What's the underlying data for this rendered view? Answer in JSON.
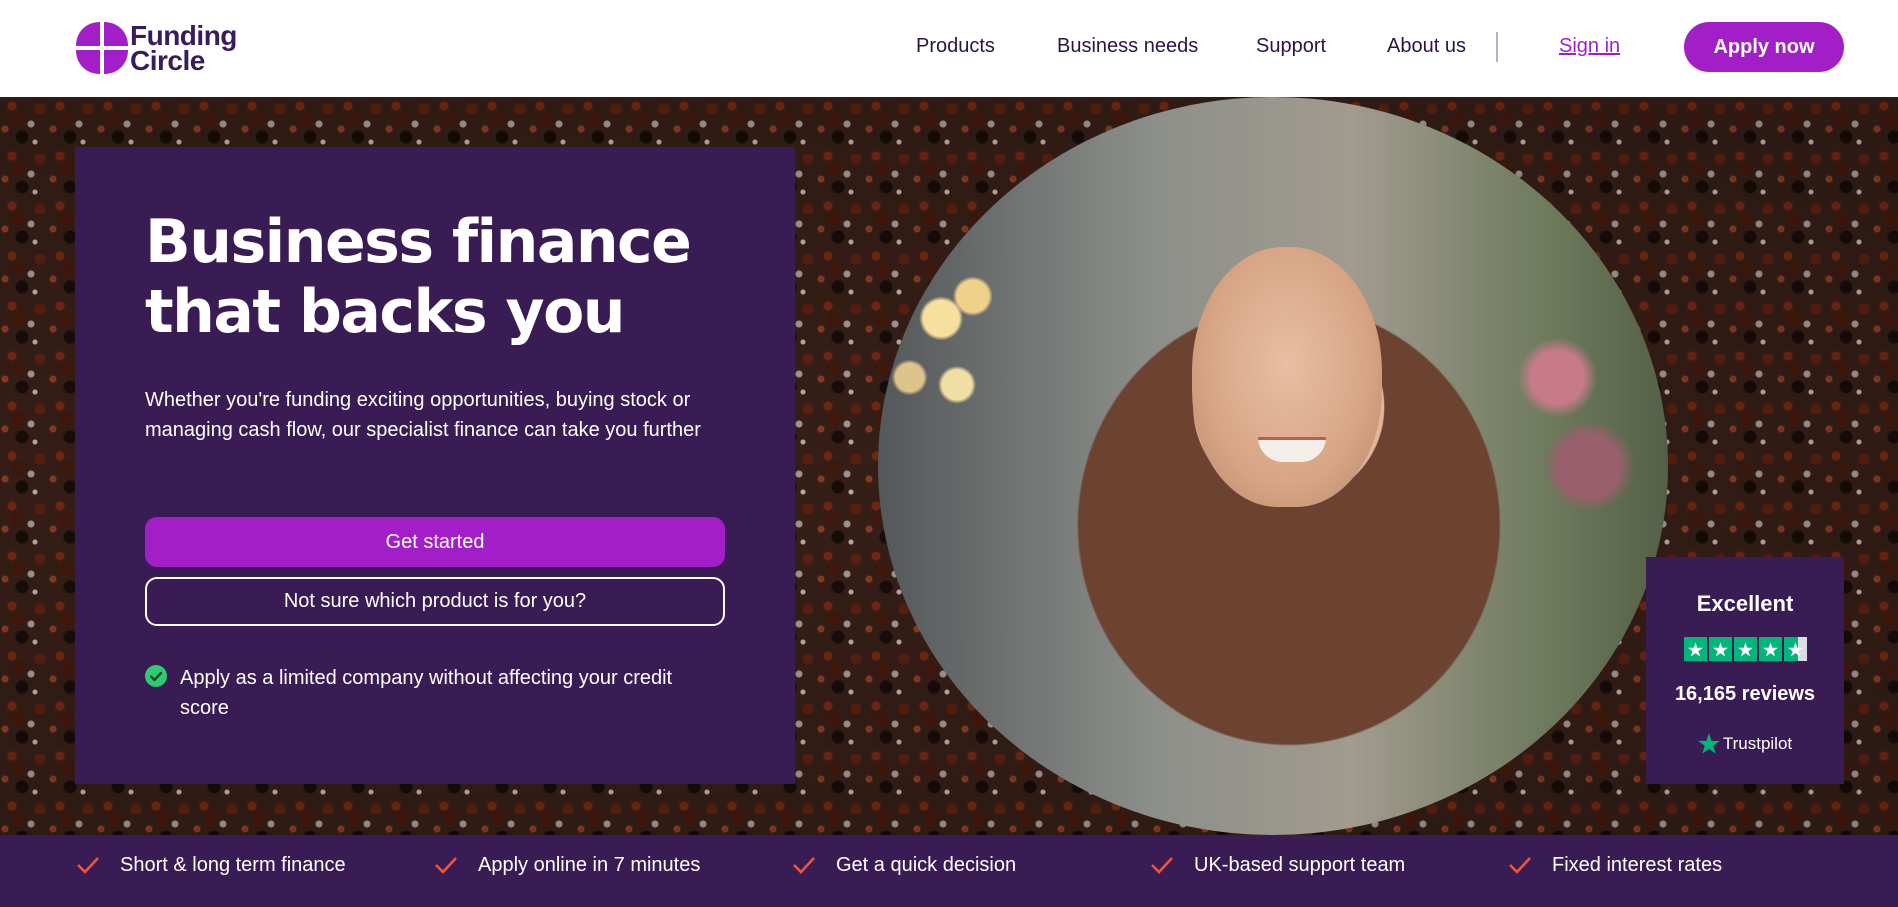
{
  "brand": {
    "name_line1": "Funding",
    "name_line2": "Circle",
    "logo_icon": "funding-circle-logo-icon"
  },
  "nav": {
    "items": [
      {
        "label": "Products"
      },
      {
        "label": "Business needs"
      },
      {
        "label": "Support"
      },
      {
        "label": "About us"
      }
    ],
    "sign_in": "Sign in",
    "apply": "Apply now"
  },
  "hero": {
    "heading_line1": "Business finance",
    "heading_line2": "that backs you",
    "lead": "Whether you're funding exciting opportunities, buying stock or managing cash flow, our specialist finance can take you further",
    "primary_cta": "Get started",
    "secondary_cta": "Not sure which product is for you?",
    "note": "Apply as a limited company without affecting your credit score",
    "note_icon": "check-circle-icon"
  },
  "trustpilot": {
    "title": "Excellent",
    "rating": 4.5,
    "rating_max": 5,
    "reviews": "16,165 reviews",
    "brand": "Trustpilot"
  },
  "features": [
    {
      "label": "Short & long term finance",
      "icon": "check-icon"
    },
    {
      "label": "Apply online in 7 minutes",
      "icon": "check-icon"
    },
    {
      "label": "Get a quick decision",
      "icon": "check-icon"
    },
    {
      "label": "UK-based support team",
      "icon": "check-icon"
    },
    {
      "label": "Fixed interest rates",
      "icon": "check-icon"
    }
  ],
  "colors": {
    "brand_purple": "#a21fc7",
    "deep_purple": "#3a1c54",
    "trustpilot_green": "#00b67a",
    "check_orange": "#f0553a"
  }
}
